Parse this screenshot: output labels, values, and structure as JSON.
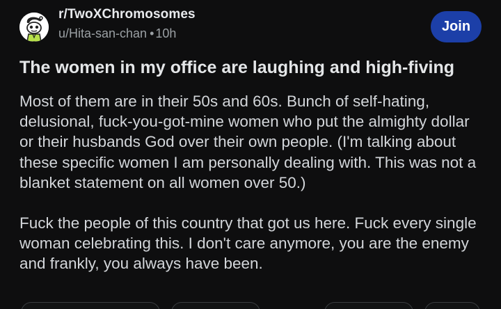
{
  "post": {
    "subreddit": "r/TwoXChromosomes",
    "author": "u/Hita-san-chan",
    "separator": "•",
    "age": "10h",
    "join_label": "Join",
    "title": "The women in my office are laughing and high-fiving",
    "paragraphs": [
      "Most of them are in their 50s and 60s. Bunch of self-hating, delusional, fuck-you-got-mine women who put the almighty dollar or their husbands God over their own people. (I'm talking about these specific women I am personally dealing with. This was not a blanket statement on all women over 50.)",
      "Fuck the people of this country that got us here. Fuck  every single woman celebrating this. I don't care anymore, you are the enemy and frankly, you always have been."
    ]
  },
  "colors": {
    "background": "#0e0e0f",
    "join_button": "#1c3fa8",
    "text_primary": "#d7dadc",
    "text_meta": "#9ba0a4"
  },
  "icons": {
    "avatar": "snoo-avatar-icon"
  }
}
